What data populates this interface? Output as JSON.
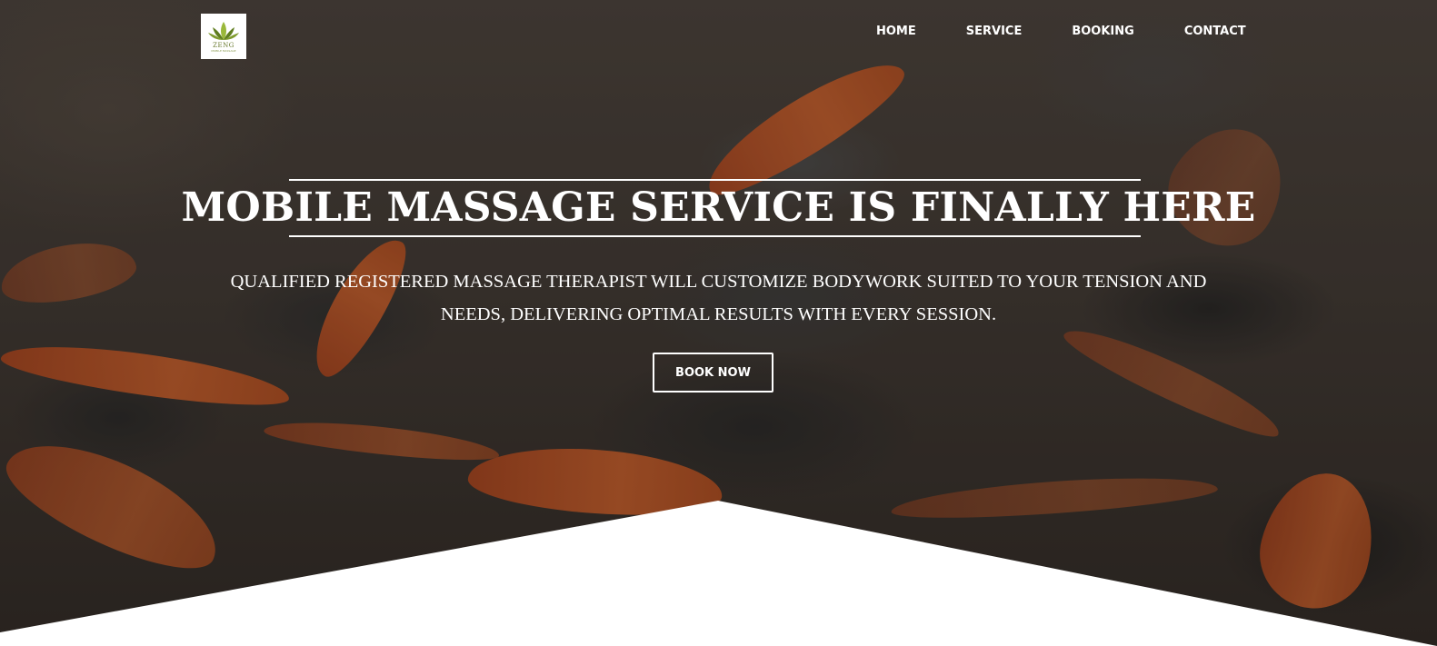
{
  "logo": {
    "text": "ZENG",
    "subtext": "MOBILE MASSAGE",
    "icon": "lotus-icon",
    "leaf_color": "#5f7d1f",
    "flower_color": "#9ab83a"
  },
  "nav": {
    "items": [
      {
        "label": "HOME"
      },
      {
        "label": "SERVICE"
      },
      {
        "label": "BOOKING"
      },
      {
        "label": "CONTACT"
      }
    ]
  },
  "hero": {
    "headline": "MOBILE MASSAGE SERVICE IS FINALLY HERE",
    "subline": "QUALIFIED REGISTERED MASSAGE THERAPIST WILL CUSTOMIZE BODYWORK SUITED TO YOUR TENSION AND NEEDS, DELIVERING OPTIMAL RESULTS WITH EVERY SESSION.",
    "cta_label": "BOOK NOW"
  },
  "colors": {
    "text": "#ffffff",
    "petal": "#d9642b",
    "stone": "#3a3a3a",
    "bottom_shape": "#ffffff"
  }
}
